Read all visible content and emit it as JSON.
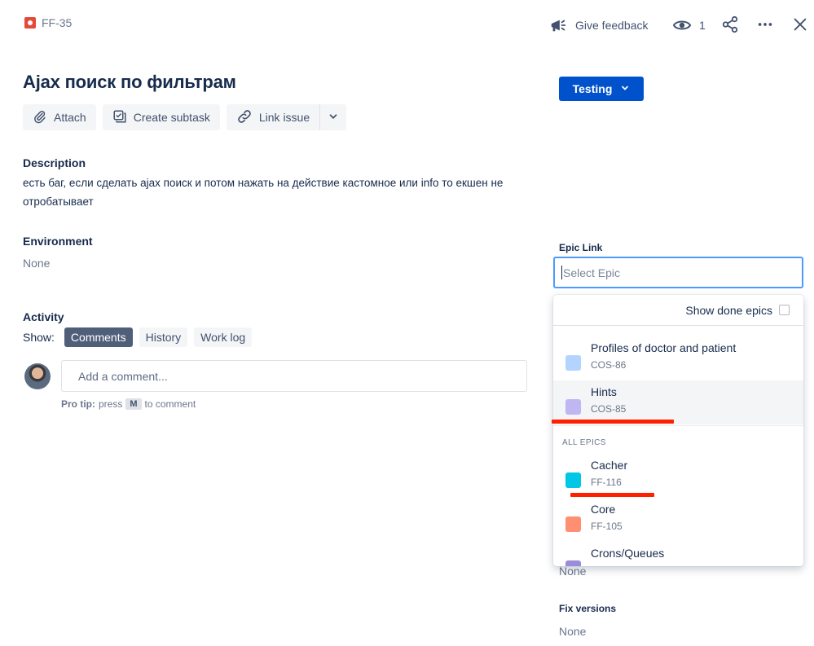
{
  "header": {
    "issue_key": "FF-35",
    "feedback_label": "Give feedback",
    "watch_count": "1"
  },
  "issue": {
    "title": "Ajax поиск по фильтрам",
    "status": "Testing"
  },
  "toolbar": {
    "attach": "Attach",
    "create_subtask": "Create subtask",
    "link_issue": "Link issue"
  },
  "description": {
    "label": "Description",
    "text": "есть баг, если сделать ajax поиск и потом нажать на действие кастомное или info то екшен не отробатывает"
  },
  "environment": {
    "label": "Environment",
    "value": "None"
  },
  "activity": {
    "label": "Activity",
    "show_label": "Show:",
    "tabs": [
      "Comments",
      "History",
      "Work log"
    ],
    "comment_placeholder": "Add a comment...",
    "pro_tip_bold": "Pro tip:",
    "pro_tip_press": "press",
    "pro_tip_key": "M",
    "pro_tip_suffix": "to comment"
  },
  "epic_link": {
    "label": "Epic Link",
    "placeholder": "Select Epic",
    "show_done": "Show done epics",
    "group_label": "ALL EPICS",
    "recent": [
      {
        "name": "Profiles of doctor and patient",
        "key": "COS-86",
        "color": "#b3d4ff"
      },
      {
        "name": "Hints",
        "key": "COS-85",
        "color": "#c0b6f2"
      }
    ],
    "all": [
      {
        "name": "Cacher",
        "key": "FF-116",
        "color": "#00c7e6"
      },
      {
        "name": "Core",
        "key": "FF-105",
        "color": "#ff8f73"
      },
      {
        "name": "Crons/Queues",
        "key": "",
        "color": "#998dd9"
      }
    ]
  },
  "sidebar": {
    "hidden_field_value": "None",
    "fix_versions_label": "Fix versions",
    "fix_versions_value": "None"
  },
  "colors": {
    "primary": "#0052cc",
    "focus_border": "#4c9aff",
    "annotation_red": "#ff2000"
  }
}
